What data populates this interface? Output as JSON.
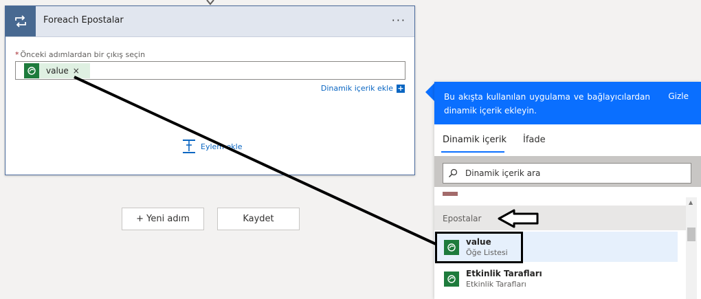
{
  "card": {
    "title": "Foreach Epostalar",
    "more": "···",
    "field_label": "Önceki adımlardan bir çıkış seçin",
    "required_mark": "*",
    "token_label": "value",
    "token_close": "×",
    "dynamic_link": "Dinamik içerik ekle",
    "dynamic_plus": "+",
    "add_action": "Eylem ekle"
  },
  "buttons": {
    "new_step": "+ Yeni adım",
    "save": "Kaydet"
  },
  "panel": {
    "banner_text": "Bu akışta kullanılan uygulama ve bağlayıcılardan dinamik içerik ekleyin.",
    "hide": "Gizle",
    "tabs": [
      {
        "label": "Dinamik içerik"
      },
      {
        "label": "İfade"
      }
    ],
    "search_placeholder": "Dinamik içerik ara",
    "section": "Epostalar",
    "items": [
      {
        "name": "value",
        "sub": "Öğe Listesi"
      },
      {
        "name": "Etkinlik Tarafları",
        "sub": "Etkinlik Tarafları"
      }
    ]
  },
  "colors": {
    "accent": "#0a6fff",
    "dataverse_green": "#1e7b3c",
    "loop_blue": "#486991"
  },
  "icons": {
    "loop": "loop-icon",
    "dataverse": "dataverse-icon",
    "search": "search-icon",
    "add_action": "add-action-icon"
  }
}
